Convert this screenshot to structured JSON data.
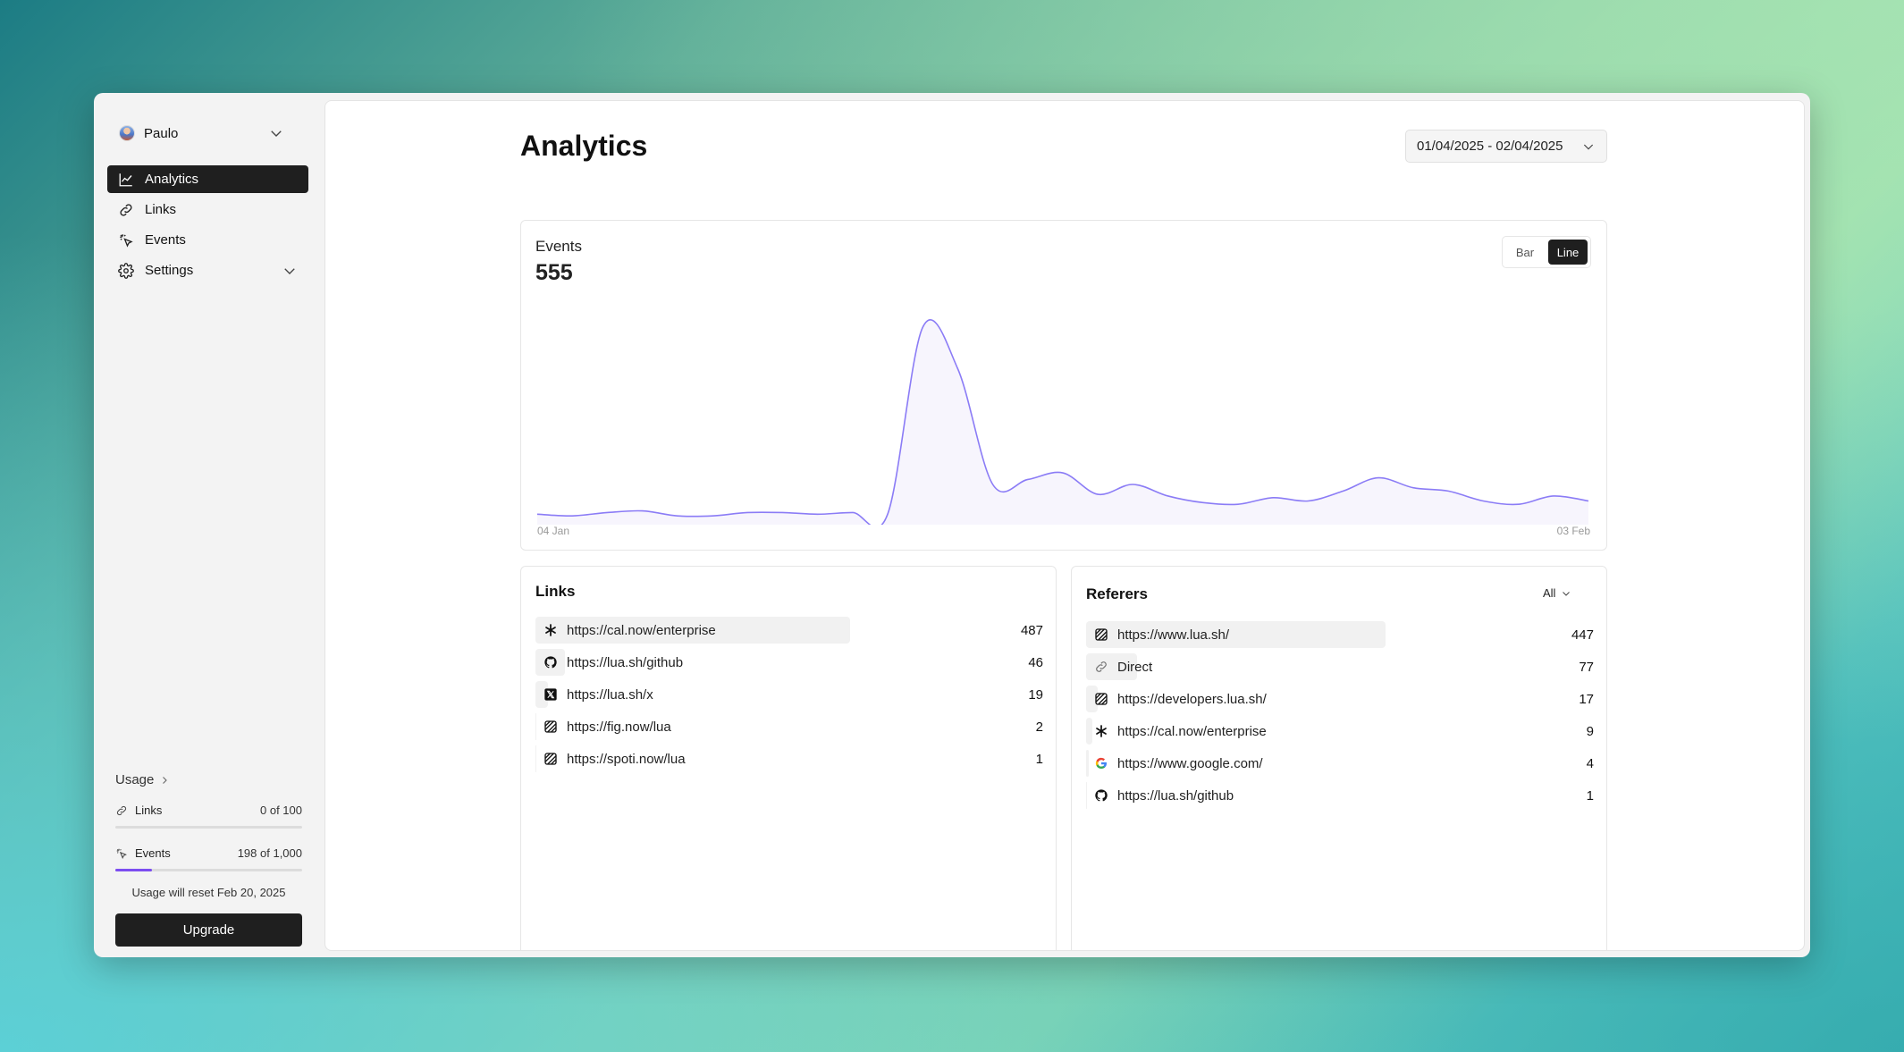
{
  "user": {
    "name": "Paulo"
  },
  "sidebar": {
    "items": [
      {
        "label": "Analytics",
        "icon": "chart-line-icon",
        "active": true
      },
      {
        "label": "Links",
        "icon": "link-icon",
        "active": false
      },
      {
        "label": "Events",
        "icon": "cursor-click-icon",
        "active": false
      },
      {
        "label": "Settings",
        "icon": "gear-icon",
        "active": false
      }
    ]
  },
  "usage": {
    "title": "Usage",
    "links_label": "Links",
    "links_value": "0 of 100",
    "links_fraction": 0.0,
    "events_label": "Events",
    "events_value": "198 of 1,000",
    "events_fraction": 0.198,
    "reset_note": "Usage will reset Feb 20, 2025",
    "upgrade_label": "Upgrade"
  },
  "main": {
    "title": "Analytics",
    "date_range": "01/04/2025 - 02/04/2025"
  },
  "events": {
    "label": "Events",
    "total": "555",
    "toggle": {
      "bar": "Bar",
      "line": "Line",
      "selected": "Line"
    },
    "x_start": "04 Jan",
    "x_end": "03 Feb"
  },
  "chart_data": {
    "type": "area",
    "title": "",
    "xlabel": "",
    "ylabel": "",
    "x": [
      "04 Jan",
      "05 Jan",
      "06 Jan",
      "07 Jan",
      "08 Jan",
      "09 Jan",
      "10 Jan",
      "11 Jan",
      "12 Jan",
      "13 Jan",
      "14 Jan",
      "15 Jan",
      "16 Jan",
      "17 Jan",
      "18 Jan",
      "19 Jan",
      "20 Jan",
      "21 Jan",
      "22 Jan",
      "23 Jan",
      "24 Jan",
      "25 Jan",
      "26 Jan",
      "27 Jan",
      "28 Jan",
      "29 Jan",
      "30 Jan",
      "31 Jan",
      "01 Feb",
      "02 Feb",
      "03 Feb"
    ],
    "series": [
      {
        "values": [
          2,
          1,
          3,
          4,
          1,
          1,
          3,
          3,
          2,
          3,
          2,
          115,
          90,
          20,
          23,
          27,
          14,
          20,
          13,
          9,
          8,
          12,
          10,
          16,
          24,
          18,
          16,
          10,
          8,
          13,
          10
        ]
      }
    ],
    "color": "#8b7cf6",
    "fill": "#f7f5fd",
    "grid": false
  },
  "links": {
    "title": "Links",
    "rows": [
      {
        "label": "https://cal.now/enterprise",
        "count": "487",
        "value": 487,
        "icon": "asterisk-icon"
      },
      {
        "label": "https://lua.sh/github",
        "count": "46",
        "value": 46,
        "icon": "github-icon"
      },
      {
        "label": "https://lua.sh/x",
        "count": "19",
        "value": 19,
        "icon": "x-logo-icon"
      },
      {
        "label": "https://fig.now/lua",
        "count": "2",
        "value": 2,
        "icon": "striped-square-icon"
      },
      {
        "label": "https://spoti.now/lua",
        "count": "1",
        "value": 1,
        "icon": "striped-square-icon"
      }
    ]
  },
  "referers": {
    "title": "Referers",
    "filter": "All",
    "rows": [
      {
        "label": "https://www.lua.sh/",
        "count": "447",
        "value": 447,
        "icon": "striped-square-icon"
      },
      {
        "label": "Direct",
        "count": "77",
        "value": 77,
        "icon": "link-icon"
      },
      {
        "label": "https://developers.lua.sh/",
        "count": "17",
        "value": 17,
        "icon": "striped-square-icon"
      },
      {
        "label": "https://cal.now/enterprise",
        "count": "9",
        "value": 9,
        "icon": "asterisk-icon"
      },
      {
        "label": "https://www.google.com/",
        "count": "4",
        "value": 4,
        "icon": "google-icon"
      },
      {
        "label": "https://lua.sh/github",
        "count": "1",
        "value": 1,
        "icon": "github-icon"
      }
    ]
  }
}
